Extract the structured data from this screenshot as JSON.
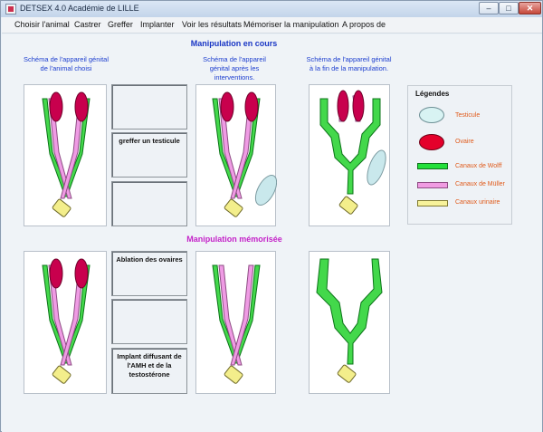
{
  "window": {
    "title": "DETSEX 4.0  Académie de LILLE",
    "minimize": "–",
    "maximize": "□",
    "close": "✕"
  },
  "menu": [
    "Choisir l'animal",
    "Castrer",
    "Greffer",
    "Implanter",
    "Voir les résultats",
    "Mémoriser la manipulation",
    "A propos de"
  ],
  "headings": {
    "current": "Manipulation en cours",
    "memorized": "Manipulation mémorisée"
  },
  "captions": {
    "chosen": "Schéma de l'appareil génital de l'animal choisi",
    "after": "Schéma de l'appareil génital après les interventions.",
    "end": "Schéma de l'appareil génital à la fin  de la manipulation."
  },
  "current_operations": [
    "",
    "greffer un testicule",
    ""
  ],
  "memorized_operations": [
    "Ablation des ovaires",
    "",
    "Implant diffusant de l'AMH et de la testostérone"
  ],
  "legend": {
    "title": "Légendes",
    "items": [
      {
        "label": "Testicule",
        "icon": "testicle-icon",
        "color": "#d8f3f3"
      },
      {
        "label": "Ovaire",
        "icon": "ovary-icon",
        "color": "#e4002b"
      },
      {
        "label": "Canaux de Wolff",
        "icon": "wolff-duct-icon",
        "color": "#22e03a"
      },
      {
        "label": "Canaux de Müller",
        "icon": "muller-duct-icon",
        "color": "#f09ce2"
      },
      {
        "label": "Canaux urinaire",
        "icon": "urinary-duct-icon",
        "color": "#f7f29a"
      }
    ]
  },
  "colors": {
    "ovary": "#c8004d",
    "muller": "#ef9be4",
    "wolff": "#43d84b",
    "urinary": "#f3ee8b",
    "testicle": "#c9e8ec",
    "heading_blue": "#1835c4",
    "heading_pink": "#c422c8",
    "legend_text": "#e05a1a"
  }
}
